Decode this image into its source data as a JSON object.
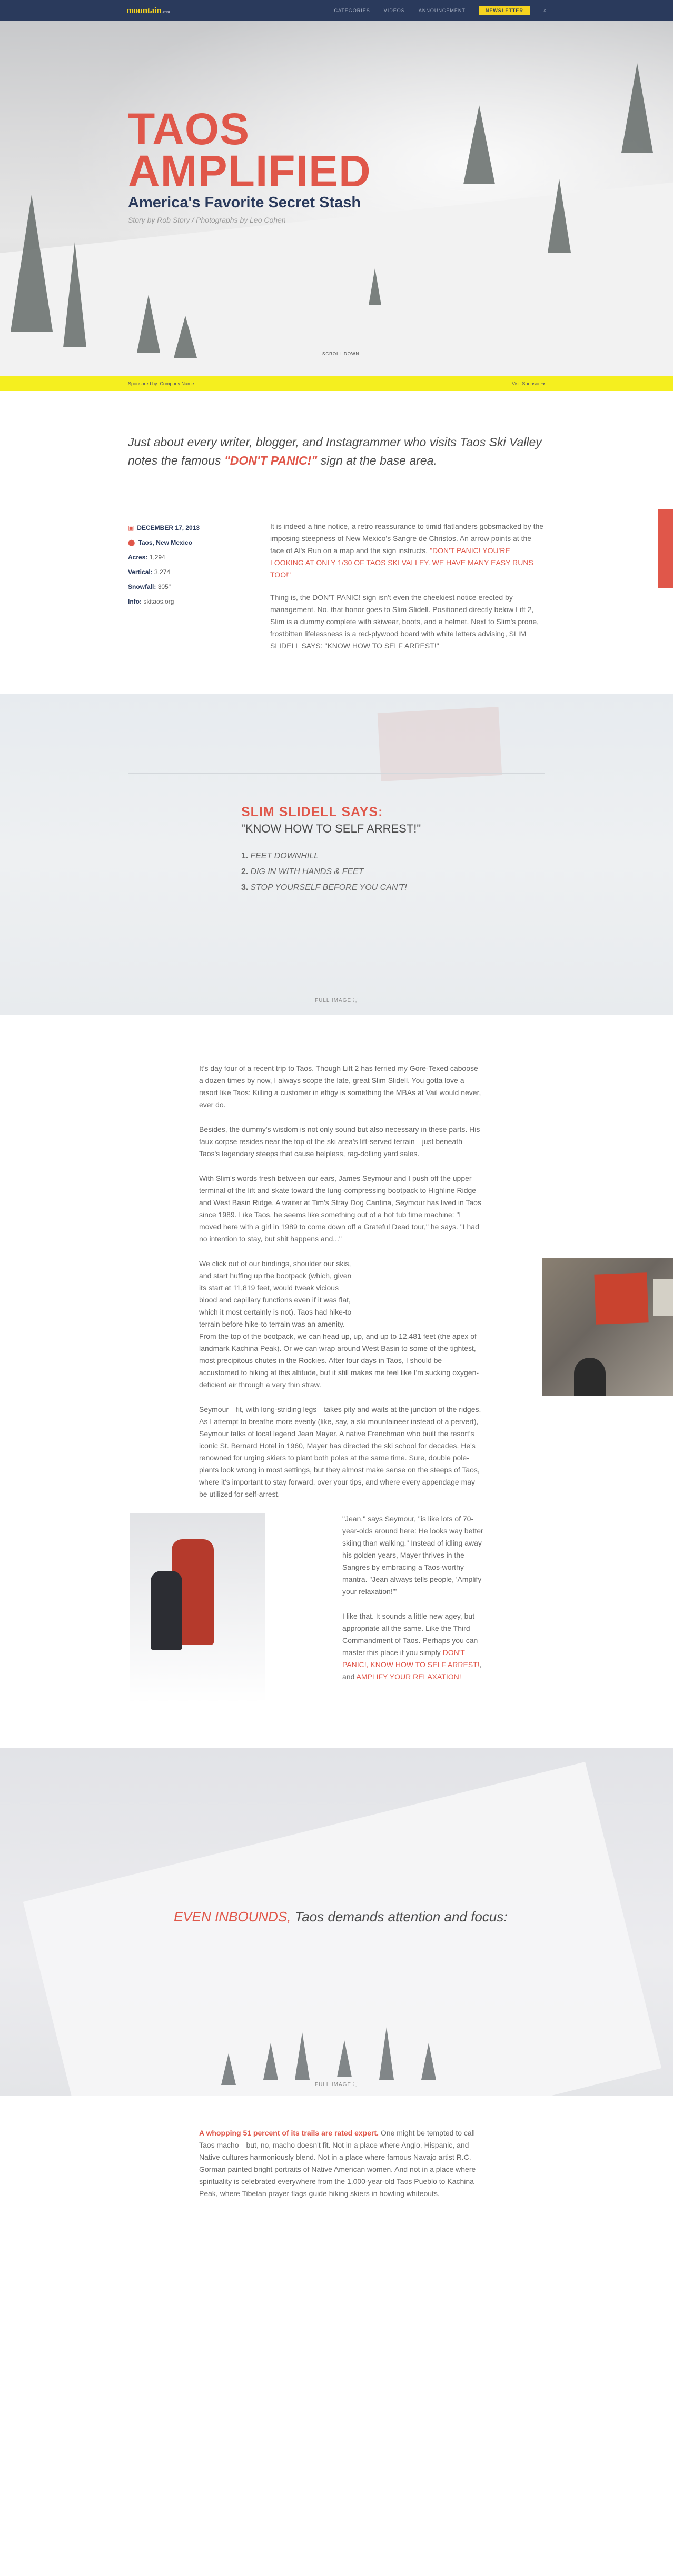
{
  "nav": {
    "logo": "mountain",
    "logo_sub": ".com",
    "items": [
      "Categories",
      "Videos",
      "Announcement"
    ],
    "newsletter": "Newsletter",
    "search_icon": "search-icon"
  },
  "hero": {
    "title_line1": "TAOS",
    "title_line2": "AMPLIFIED",
    "subtitle": "America's Favorite Secret Stash",
    "byline": "Story by Rob Story / Photographs by Leo Cohen",
    "scroll": "SCROLL DOWN"
  },
  "sponsor": {
    "left": "Sponsored by: Company Name",
    "right": "Visit Sponsor ➔"
  },
  "intro": {
    "lede_pre": "Just about every writer, blogger, and Instagrammer who visits Taos Ski Valley notes the famous ",
    "lede_hl": "\"DON'T PANIC!\"",
    "lede_post": " sign at the base area."
  },
  "sidebar": {
    "date": "DECEMBER 17, 2013",
    "location": "Taos, New Mexico",
    "acres_label": "Acres:",
    "acres": "1,294",
    "vertical_label": "Vertical:",
    "vertical": "3,274",
    "snowfall_label": "Snowfall:",
    "snowfall": "305\"",
    "info_label": "Info:",
    "info": "skitaos.org"
  },
  "body_intro": {
    "p1_pre": "It is indeed a fine notice, a retro reassurance to timid flatlanders gobsmacked by the imposing steepness of New Mexico's Sangre de Christos. An arrow points at the face of Al's Run on a map and the sign instructs, ",
    "p1_hl": "\"DON'T PANIC! YOU'RE LOOKING AT ONLY 1/30 OF TAOS SKI VALLEY. WE HAVE MANY EASY RUNS TOO!\"",
    "p2": "Thing is, the DON'T PANIC! sign isn't even the cheekiest notice erected by management. No, that honor goes to Slim Slidell. Positioned directly below Lift 2, Slim is a dummy complete with skiwear, boots, and a helmet. Next to Slim's prone, frostbitten lifelessness is a red-plywood board with white letters advising, SLIM SLIDELL SAYS: \"KNOW HOW TO SELF ARREST!\""
  },
  "panel1": {
    "kicker": "SLIM SLIDELL SAYS:",
    "quote": "\"KNOW HOW TO SELF ARREST!\"",
    "items": [
      "FEET DOWNHILL",
      "DIG IN WITH HANDS & FEET",
      "STOP YOURSELF BEFORE YOU CAN'T!"
    ],
    "nums": [
      "1.",
      "2.",
      "3."
    ],
    "full_image": "FULL IMAGE ⛶"
  },
  "story": {
    "p1": "It's day four of a recent trip to Taos. Though Lift 2 has ferried my Gore-Texed caboose a dozen times by now, I always scope the late, great Slim Slidell. You gotta love a resort like Taos: Killing a customer in effigy is something the MBAs at Vail would never, ever do.",
    "p2": "Besides, the dummy's wisdom is not only sound but also necessary in these parts. His faux corpse resides near the top of the ski area's lift-served terrain—just beneath Taos's legendary steeps that cause helpless, rag-dolling yard sales.",
    "p3": "With Slim's words fresh between our ears, James Seymour and I push off the upper terminal of the lift and skate toward the lung-compressing bootpack to Highline Ridge and West Basin Ridge. A waiter at Tim's Stray Dog Cantina, Seymour has lived in Taos since 1989. Like Taos, he seems like something out of a hot tub time machine: \"I moved here with a girl in 1989 to come down off a Grateful Dead tour,\" he says. \"I had no intention to stay, but shit happens and...\"",
    "p4a": "We click out of our bindings, shoulder our skis, and start huffing up the bootpack (which, given its start at 11,819 feet, would tweak vicious blood and capillary functions even if it was flat, which it most certainly is not). Taos had hike-to terrain before hike-to terrain was an amenity.",
    "p4b": "From the top of the bootpack, we can head up, up, and up to 12,481 feet (the apex of landmark Kachina Peak). Or we can wrap around West Basin to some of the tightest, most precipitous chutes in the Rockies. After four days in Taos, I should be accustomed to hiking at this altitude, but it still makes me feel like I'm sucking oxygen-deficient air through a very thin straw.",
    "p5": "Seymour—fit, with long-striding legs—takes pity and waits at the junction of the ridges. As I attempt to breathe more evenly (like, say, a ski mountaineer instead of a pervert), Seymour talks of local legend Jean Mayer. A native Frenchman who built the resort's iconic St. Bernard Hotel in 1960, Mayer has directed the ski school for decades. He's renowned for urging skiers to plant both poles at the same time. Sure, double pole-plants look wrong in most settings, but they almost make sense on the steeps of Taos, where it's important to stay forward, over your tips, and where every appendage may be utilized for self-arrest.",
    "p6": "\"Jean,\" says Seymour, \"is like lots of 70-year-olds around here: He looks way better skiing than walking.\" Instead of idling away his golden years, Mayer thrives in the Sangres by embracing a Taos-worthy mantra. \"Jean always tells people, 'Amplify your relaxation!'\"",
    "p7_pre": "I like that. It sounds a little new agey, but appropriate all the same. Like the Third Commandment of Taos. Perhaps you can master this place if you simply ",
    "p7_hl1": "DON'T PANIC!, KNOW HOW TO SELF ARREST!",
    "p7_mid": ", and ",
    "p7_hl2": "AMPLIFY YOUR RELAXATION!"
  },
  "panel2": {
    "head_hl": "EVEN INBOUNDS,",
    "head_rest": " Taos demands attention and focus:",
    "full_image": "FULL IMAGE ⛶"
  },
  "outro": {
    "hl": "A whopping 51 percent of its trails are rated expert.",
    "text": " One might be tempted to call Taos macho—but, no, macho doesn't fit. Not in a place where Anglo, Hispanic, and Native cultures harmoniously blend. Not in a place where famous Navajo artist R.C. Gorman painted bright portraits of Native American women. And not in a place where spirituality is celebrated everywhere from the 1,000-year-old Taos Pueblo to Kachina Peak, where Tibetan prayer flags guide hiking skiers in howling whiteouts."
  }
}
